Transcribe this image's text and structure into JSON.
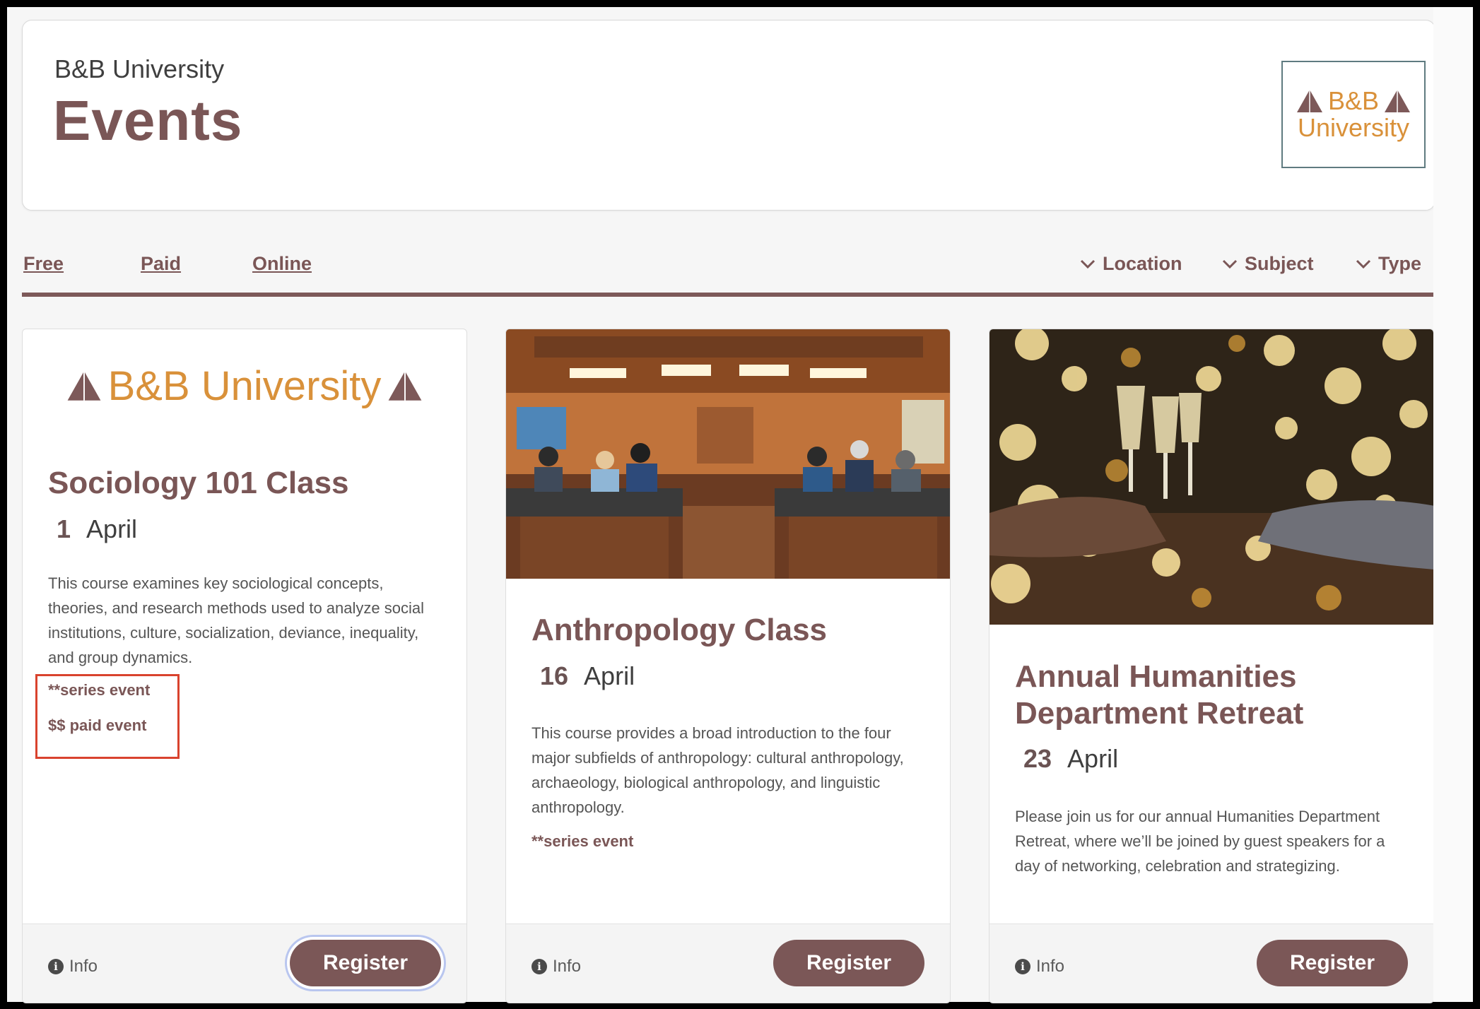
{
  "header": {
    "subtitle": "B&B University",
    "title": "Events",
    "logo": {
      "line1": "B&B",
      "line2": "University"
    }
  },
  "filters": {
    "links": [
      "Free",
      "Paid",
      "Online"
    ],
    "dropdowns": [
      "Location",
      "Subject",
      "Type"
    ]
  },
  "cards": [
    {
      "banner": "B&B University",
      "title": "Sociology 101 Class",
      "day": "1",
      "month": "April",
      "description": "This course examines key sociological concepts, theories, and research methods used to analyze social institutions, culture, socialization, deviance, inequality, and group dynamics.",
      "tags": [
        "**series event",
        "$$ paid event"
      ],
      "info_label": "Info",
      "register_label": "Register"
    },
    {
      "title": "Anthropology Class",
      "day": "16",
      "month": "April",
      "description": "This course provides a broad introduction to the four major subfields of anthropology: cultural anthropology, archaeology, biological anthropology, and linguistic anthropology.",
      "tags": [
        "**series event"
      ],
      "info_label": "Info",
      "register_label": "Register"
    },
    {
      "title": "Annual Humanities Department Retreat",
      "day": "23",
      "month": "April",
      "description": "Please join us for our annual Humanities Department Retreat, where we’ll be joined by guest speakers for a day of networking, celebration and strategizing.",
      "tags": [],
      "info_label": "Info",
      "register_label": "Register"
    }
  ],
  "colors": {
    "brand": "#7b5757",
    "logo_gold": "#d9913a",
    "highlight": "#d9432e"
  }
}
